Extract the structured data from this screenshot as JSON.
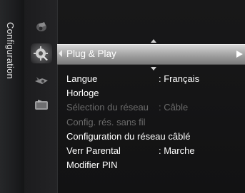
{
  "side_tab": {
    "title": "Configuration"
  },
  "icons": [
    {
      "name": "picture-icon"
    },
    {
      "name": "setup-gear-icon"
    },
    {
      "name": "input-icon"
    },
    {
      "name": "application-icon"
    }
  ],
  "menu": {
    "items": [
      {
        "label": "Plug & Play",
        "value": "",
        "state": "selected",
        "has_submenu": true
      },
      {
        "label": "Langue",
        "value": ": Français",
        "state": "normal"
      },
      {
        "label": "Horloge",
        "value": "",
        "state": "normal"
      },
      {
        "label": "Sélection du réseau",
        "value": ": Câble",
        "state": "disabled"
      },
      {
        "label": "Config. rés. sans fil",
        "value": "",
        "state": "disabled"
      },
      {
        "label": "Configuration du réseau câblé",
        "value": "",
        "state": "normal"
      },
      {
        "label": "Verr Parental",
        "value": ": Marche",
        "state": "normal"
      },
      {
        "label": "Modifier PIN",
        "value": "",
        "state": "normal"
      }
    ]
  },
  "colors": {
    "background": "#121213",
    "text": "#ffffff",
    "disabled_text": "#6a6a6a",
    "highlight": "#a9a9a9"
  }
}
